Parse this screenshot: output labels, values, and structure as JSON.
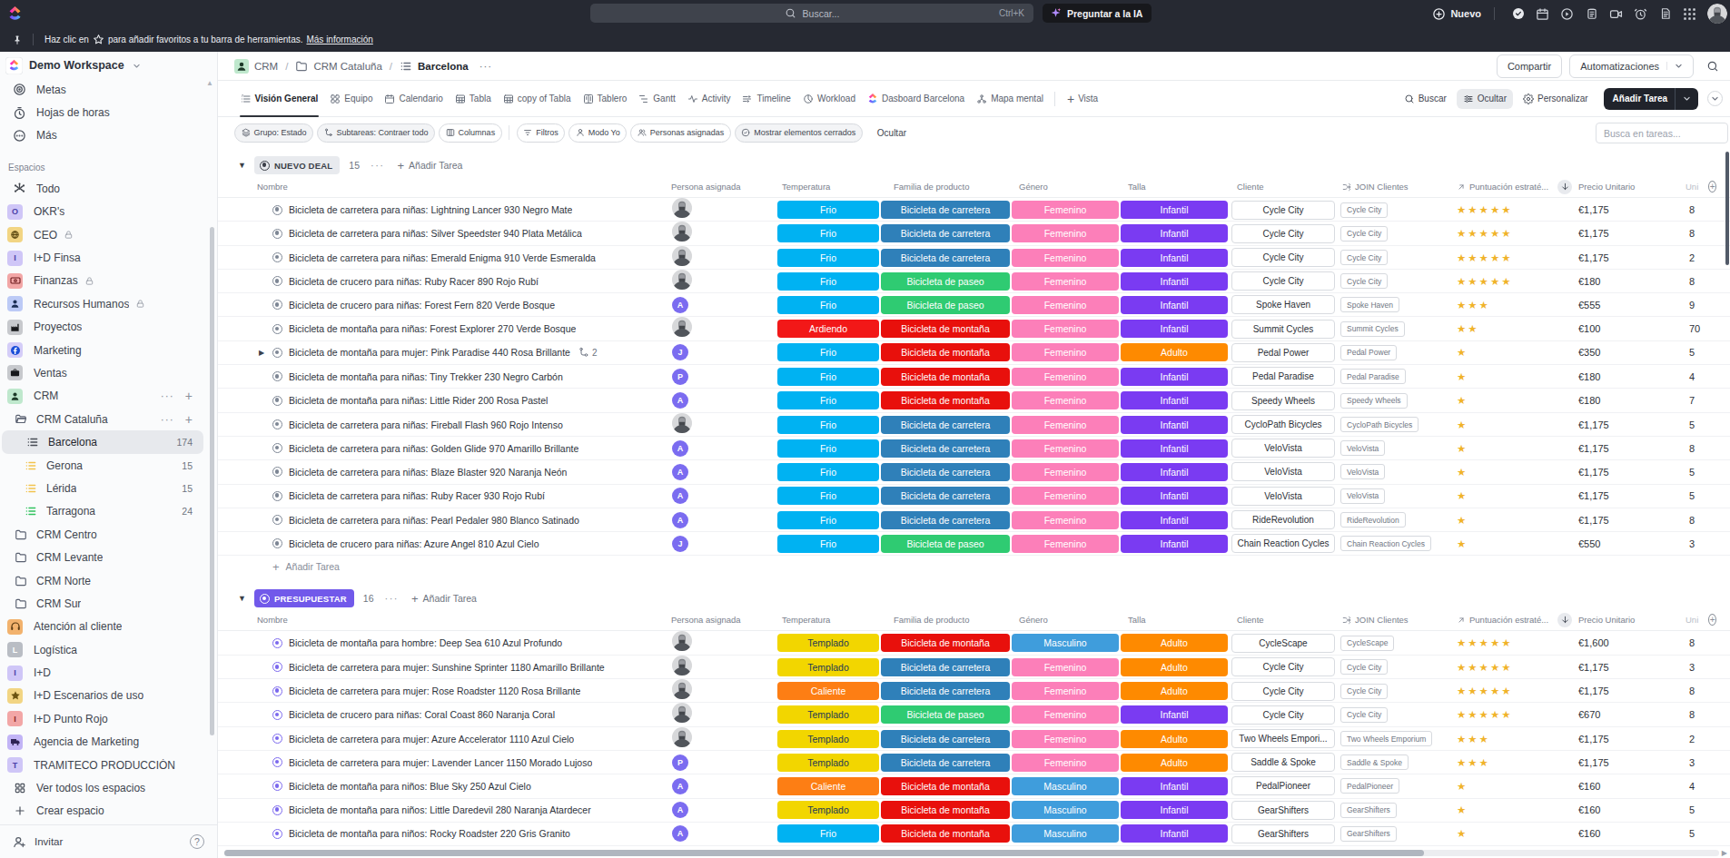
{
  "topbar": {
    "search": {
      "placeholder": "Buscar...",
      "shortcut": "Ctrl+K"
    },
    "ask_ai_label": "Preguntar a la IA",
    "new_label": "Nuevo",
    "icons": [
      "todo-check-icon",
      "calendar-icon",
      "record-icon",
      "clipboard-icon",
      "video-icon",
      "reminder-icon",
      "notepad-icon",
      "app-grid-icon"
    ]
  },
  "banner": {
    "text_before": "Haz clic en",
    "text_after": "para añadir favoritos a tu barra de herramientas.",
    "link_label": "Más información"
  },
  "sidebar": {
    "workspace_name": "Demo Workspace",
    "section_label": "Espacios",
    "items": [
      {
        "type": "item",
        "label": "Metas",
        "icon": "goal"
      },
      {
        "type": "item",
        "label": "Hojas de horas",
        "icon": "timer"
      },
      {
        "type": "item",
        "label": "Más",
        "icon": "more-circle"
      },
      {
        "type": "section",
        "label": "Espacios"
      },
      {
        "type": "item",
        "label": "Todo",
        "icon": "everything"
      },
      {
        "type": "space",
        "label": "OKR's",
        "letter": "O",
        "bg": "#cfc6f7",
        "fg": "#4b3fa8"
      },
      {
        "type": "space",
        "label": "CEO",
        "icon": "gear-globe",
        "bg": "#f2d583",
        "fg": "#5d4a11",
        "lock": true
      },
      {
        "type": "space",
        "label": "I+D Finsa",
        "letter": "I",
        "bg": "#cfc6f7",
        "fg": "#4b3fa8"
      },
      {
        "type": "space",
        "label": "Finanzas",
        "icon": "banknote",
        "bg": "#f2a6a6",
        "fg": "#6d1a1d",
        "lock": true
      },
      {
        "type": "space",
        "label": "Recursos Humanos",
        "icon": "person",
        "bg": "#bccaf6",
        "fg": "#1c2f55",
        "lock": true
      },
      {
        "type": "space",
        "label": "Proyectos",
        "icon": "factory",
        "bg": "#c7c9cd",
        "fg": "#17181b"
      },
      {
        "type": "space",
        "label": "Marketing",
        "icon": "meta",
        "bg": "#d4cdf8",
        "fg": "#1b4ed8"
      },
      {
        "type": "space",
        "label": "Ventas",
        "icon": "briefcase",
        "bg": "#c7c9cd",
        "fg": "#17181b"
      },
      {
        "type": "space",
        "label": "CRM",
        "icon": "person",
        "bg": "#bfe8cd",
        "fg": "#1d3a28",
        "hover": true
      },
      {
        "type": "folder",
        "label": "CRM Cataluña",
        "open": true,
        "hover": true
      },
      {
        "type": "list",
        "label": "Barcelona",
        "count": "174",
        "color": "#474c55",
        "selected": true
      },
      {
        "type": "list",
        "label": "Gerona",
        "count": "15",
        "color": "#f2c34c"
      },
      {
        "type": "list",
        "label": "Lérida",
        "count": "15",
        "color": "#f2c34c"
      },
      {
        "type": "list",
        "label": "Tarragona",
        "count": "24",
        "color": "#31c25e"
      },
      {
        "type": "folder",
        "label": "CRM Centro"
      },
      {
        "type": "folder",
        "label": "CRM Levante"
      },
      {
        "type": "folder",
        "label": "CRM Norte"
      },
      {
        "type": "folder",
        "label": "CRM Sur"
      },
      {
        "type": "space",
        "label": "Atención al cliente",
        "icon": "headset",
        "bg": "#f2b26d",
        "fg": "#5a3a12"
      },
      {
        "type": "space",
        "label": "Logística",
        "letter": "L",
        "bg": "#b9bdc4",
        "fg": "#fff"
      },
      {
        "type": "space",
        "label": "I+D",
        "letter": "I",
        "bg": "#cfc6f7",
        "fg": "#4b3fa8"
      },
      {
        "type": "space",
        "label": "I+D Escenarios de uso",
        "icon": "star",
        "bg": "#f2d583",
        "fg": "#6b5410"
      },
      {
        "type": "space",
        "label": "I+D Punto Rojo",
        "letter": "I",
        "bg": "#f2a6a6",
        "fg": "#8a2424"
      },
      {
        "type": "space",
        "label": "Agencia de Marketing",
        "icon": "truck",
        "bg": "#c2b4f6",
        "fg": "#2e2355"
      },
      {
        "type": "space",
        "label": "TRAMITECO PRODUCCIÓN",
        "letter": "T",
        "bg": "#cfc6f7",
        "fg": "#4b3fa8"
      },
      {
        "type": "item",
        "label": "Ver todos los espacios",
        "icon": "grid4"
      },
      {
        "type": "item",
        "label": "Crear espacio",
        "icon": "plus"
      }
    ],
    "footer": {
      "invite_label": "Invitar",
      "help_icon": "help"
    }
  },
  "breadcrumb": {
    "crumbs": [
      {
        "label": "CRM",
        "icon": "crm-space"
      },
      {
        "label": "CRM Cataluña",
        "icon": "folder"
      },
      {
        "label": "Barcelona",
        "icon": "list-lines",
        "current": true
      }
    ],
    "more": "···",
    "share_label": "Compartir",
    "automations_label": "Automatizaciones"
  },
  "view_tabs": {
    "tabs": [
      {
        "label": "Visión General",
        "icon": "overview",
        "active": true
      },
      {
        "label": "Equipo",
        "icon": "team"
      },
      {
        "label": "Calendario",
        "icon": "calendar2"
      },
      {
        "label": "Tabla",
        "icon": "table"
      },
      {
        "label": "copy of Tabla",
        "icon": "table"
      },
      {
        "label": "Tablero",
        "icon": "board"
      },
      {
        "label": "Gantt",
        "icon": "gantt"
      },
      {
        "label": "Activity",
        "icon": "activity"
      },
      {
        "label": "Timeline",
        "icon": "timeline"
      },
      {
        "label": "Workload",
        "icon": "workload"
      },
      {
        "label": "Dasboard Barcelona",
        "icon": "clickup-color"
      },
      {
        "label": "Mapa mental",
        "icon": "mindmap"
      }
    ],
    "add_view_label": "Vista",
    "search_label": "Buscar",
    "hide_label": "Ocultar",
    "customize_label": "Personalizar",
    "add_task_label": "Añadir Tarea"
  },
  "toolbar": {
    "pills": [
      {
        "label": "Grupo: Estado",
        "icon": "layers",
        "shaded": true
      },
      {
        "label": "Subtareas: Contraer todo",
        "icon": "subtask",
        "shaded": true
      },
      {
        "label": "Columnas",
        "icon": "columns",
        "shaded": false,
        "sep_after": true
      },
      {
        "label": "Filtros",
        "icon": "filter",
        "shaded": false
      },
      {
        "label": "Modo Yo",
        "icon": "person-o",
        "shaded": false
      },
      {
        "label": "Personas asignadas",
        "icon": "people",
        "shaded": false
      },
      {
        "label": "Mostrar elementos cerrados",
        "icon": "check-circle",
        "shaded": true
      }
    ],
    "plain_label": "Ocultar",
    "task_search_placeholder": "Busca en tareas..."
  },
  "table": {
    "columns": {
      "name": "Nombre",
      "assignee": "Persona asignada",
      "temperatura": "Temperatura",
      "familia": "Familia de producto",
      "genero": "Género",
      "talla": "Talla",
      "cliente": "Cliente",
      "join": "JOIN Clientes",
      "puntuacion": "Puntuación estraté...",
      "precio": "Precio Unitario",
      "unidades": "Uni"
    },
    "add_task_label": "Añadir Tarea",
    "option_colors": {
      "Frio": {
        "bg": "#00b2f2",
        "fg": "#fff"
      },
      "Ardiendo": {
        "bg": "#f21818",
        "fg": "#fff"
      },
      "Templado": {
        "bg": "#f2d600",
        "fg": "#233a56"
      },
      "Caliente": {
        "bg": "#fd7e14",
        "fg": "#fff"
      },
      "Bicicleta de carretera": {
        "bg": "#2f80b9",
        "fg": "#fff"
      },
      "Bicicleta de paseo": {
        "bg": "#2fcb72",
        "fg": "#fff"
      },
      "Bicicleta de montaña": {
        "bg": "#e8100c",
        "fg": "#fff"
      },
      "Femenino": {
        "bg": "#fc7fb9",
        "fg": "#fff"
      },
      "Masculino": {
        "bg": "#3f9ddc",
        "fg": "#fff"
      },
      "Infantil": {
        "bg": "#7a3bf2",
        "fg": "#fff"
      },
      "Adulto": {
        "bg": "#fe8a00",
        "fg": "#fff"
      }
    },
    "star_color": "#f0b32a",
    "avatar_color": "#7b6cf0",
    "groups": [
      {
        "status": "NUEVO DEAL",
        "pill_bg": "#e8eaee",
        "pill_fg": "#3b3f48",
        "dot_color": "#7d8694",
        "count": "15",
        "show_add_row": true,
        "rows": [
          {
            "name": "Bicicleta de carretera para niñas: Lightning Lancer 930 Negro Mate",
            "avatar": "photo",
            "temperatura": "Frio",
            "familia": "Bicicleta de carretera",
            "genero": "Femenino",
            "talla": "Infantil",
            "cliente": "Cycle City",
            "join": "Cycle City",
            "stars": 5,
            "precio": "€1,175",
            "unidades": "8"
          },
          {
            "name": "Bicicleta de carretera para niñas: Silver Speedster 940 Plata Metálica",
            "avatar": "photo",
            "temperatura": "Frio",
            "familia": "Bicicleta de carretera",
            "genero": "Femenino",
            "talla": "Infantil",
            "cliente": "Cycle City",
            "join": "Cycle City",
            "stars": 5,
            "precio": "€1,175",
            "unidades": "8"
          },
          {
            "name": "Bicicleta de carretera para niñas: Emerald Enigma 910 Verde Esmeralda",
            "avatar": "photo",
            "temperatura": "Frio",
            "familia": "Bicicleta de carretera",
            "genero": "Femenino",
            "talla": "Infantil",
            "cliente": "Cycle City",
            "join": "Cycle City",
            "stars": 5,
            "precio": "€1,175",
            "unidades": "2"
          },
          {
            "name": "Bicicleta de crucero para niñas: Ruby Racer 890 Rojo Rubí",
            "avatar": "photo",
            "temperatura": "Frio",
            "familia": "Bicicleta de paseo",
            "genero": "Femenino",
            "talla": "Infantil",
            "cliente": "Cycle City",
            "join": "Cycle City",
            "stars": 5,
            "precio": "€180",
            "unidades": "8"
          },
          {
            "name": "Bicicleta de crucero para niñas: Forest Fern 820 Verde Bosque",
            "avatar": "A",
            "temperatura": "Frio",
            "familia": "Bicicleta de paseo",
            "genero": "Femenino",
            "talla": "Infantil",
            "cliente": "Spoke Haven",
            "join": "Spoke Haven",
            "stars": 3,
            "precio": "€555",
            "unidades": "9"
          },
          {
            "name": "Bicicleta de montaña para niñas: Forest Explorer 270 Verde Bosque",
            "avatar": "photo",
            "temperatura": "Ardiendo",
            "familia": "Bicicleta de montaña",
            "genero": "Femenino",
            "talla": "Infantil",
            "cliente": "Summit Cycles",
            "join": "Summit Cycles",
            "stars": 2,
            "precio": "€100",
            "unidades": "70"
          },
          {
            "name": "Bicicleta de montaña para mujer: Pink Paradise 440 Rosa Brillante",
            "avatar": "J",
            "temperatura": "Frio",
            "familia": "Bicicleta de montaña",
            "genero": "Femenino",
            "talla": "Adulto",
            "cliente": "Pedal Power",
            "join": "Pedal Power",
            "stars": 1,
            "precio": "€350",
            "unidades": "5",
            "expandable": true,
            "subtasks": "2"
          },
          {
            "name": "Bicicleta de montaña para niñas: Tiny Trekker 230 Negro Carbón",
            "avatar": "P",
            "temperatura": "Frio",
            "familia": "Bicicleta de montaña",
            "genero": "Femenino",
            "talla": "Infantil",
            "cliente": "Pedal Paradise",
            "join": "Pedal Paradise",
            "stars": 1,
            "precio": "€180",
            "unidades": "4"
          },
          {
            "name": "Bicicleta de montaña para niñas: Little Rider 200 Rosa Pastel",
            "avatar": "A",
            "temperatura": "Frio",
            "familia": "Bicicleta de montaña",
            "genero": "Femenino",
            "talla": "Infantil",
            "cliente": "Speedy Wheels",
            "join": "Speedy Wheels",
            "stars": 1,
            "precio": "€180",
            "unidades": "7"
          },
          {
            "name": "Bicicleta de carretera para niñas: Fireball Flash 960 Rojo Intenso",
            "avatar": "photo",
            "temperatura": "Frio",
            "familia": "Bicicleta de carretera",
            "genero": "Femenino",
            "talla": "Infantil",
            "cliente": "CycloPath Bicycles",
            "join": "CycloPath Bicycles",
            "stars": 1,
            "precio": "€1,175",
            "unidades": "5"
          },
          {
            "name": "Bicicleta de carretera para niñas: Golden Glide 970 Amarillo Brillante",
            "avatar": "A",
            "temperatura": "Frio",
            "familia": "Bicicleta de carretera",
            "genero": "Femenino",
            "talla": "Infantil",
            "cliente": "VeloVista",
            "join": "VeloVista",
            "stars": 1,
            "precio": "€1,175",
            "unidades": "8"
          },
          {
            "name": "Bicicleta de carretera para niñas: Blaze Blaster 920 Naranja Neón",
            "avatar": "A",
            "temperatura": "Frio",
            "familia": "Bicicleta de carretera",
            "genero": "Femenino",
            "talla": "Infantil",
            "cliente": "VeloVista",
            "join": "VeloVista",
            "stars": 1,
            "precio": "€1,175",
            "unidades": "5"
          },
          {
            "name": "Bicicleta de carretera para niñas: Ruby Racer 930 Rojo Rubí",
            "avatar": "A",
            "temperatura": "Frio",
            "familia": "Bicicleta de carretera",
            "genero": "Femenino",
            "talla": "Infantil",
            "cliente": "VeloVista",
            "join": "VeloVista",
            "stars": 1,
            "precio": "€1,175",
            "unidades": "5"
          },
          {
            "name": "Bicicleta de carretera para niñas: Pearl Pedaler 980 Blanco Satinado",
            "avatar": "A",
            "temperatura": "Frio",
            "familia": "Bicicleta de carretera",
            "genero": "Femenino",
            "talla": "Infantil",
            "cliente": "RideRevolution",
            "join": "RideRevolution",
            "stars": 1,
            "precio": "€1,175",
            "unidades": "8"
          },
          {
            "name": "Bicicleta de crucero para niñas: Azure Angel 810 Azul Cielo",
            "avatar": "J",
            "temperatura": "Frio",
            "familia": "Bicicleta de paseo",
            "genero": "Femenino",
            "talla": "Infantil",
            "cliente": "Chain Reaction Cycles",
            "join": "Chain Reaction Cycles",
            "stars": 1,
            "precio": "€550",
            "unidades": "3"
          }
        ]
      },
      {
        "status": "PRESUPUESTAR",
        "pill_bg": "#7159ea",
        "pill_fg": "#ffffff",
        "dot_color": "#7b68ee",
        "count": "16",
        "show_add_row": false,
        "rows": [
          {
            "name": "Bicicleta de montaña para hombre: Deep Sea 610 Azul Profundo",
            "avatar": "photo",
            "temperatura": "Templado",
            "familia": "Bicicleta de montaña",
            "genero": "Masculino",
            "talla": "Adulto",
            "cliente": "CycleScape",
            "join": "CycleScape",
            "stars": 5,
            "precio": "€1,600",
            "unidades": "8"
          },
          {
            "name": "Bicicleta de carretera para mujer: Sunshine Sprinter 1180 Amarillo Brillante",
            "avatar": "photo",
            "temperatura": "Templado",
            "familia": "Bicicleta de carretera",
            "genero": "Femenino",
            "talla": "Adulto",
            "cliente": "Cycle City",
            "join": "Cycle City",
            "stars": 5,
            "precio": "€1,175",
            "unidades": "3"
          },
          {
            "name": "Bicicleta de carretera para mujer: Rose Roadster 1120 Rosa Brillante",
            "avatar": "photo",
            "temperatura": "Caliente",
            "familia": "Bicicleta de carretera",
            "genero": "Femenino",
            "talla": "Adulto",
            "cliente": "Cycle City",
            "join": "Cycle City",
            "stars": 5,
            "precio": "€1,175",
            "unidades": "8"
          },
          {
            "name": "Bicicleta de crucero para niñas: Coral Coast 860 Naranja Coral",
            "avatar": "photo",
            "temperatura": "Templado",
            "familia": "Bicicleta de paseo",
            "genero": "Femenino",
            "talla": "Infantil",
            "cliente": "Cycle City",
            "join": "Cycle City",
            "stars": 5,
            "precio": "€670",
            "unidades": "8"
          },
          {
            "name": "Bicicleta de carretera para mujer: Azure Accelerator 1110 Azul Cielo",
            "avatar": "photo",
            "temperatura": "Templado",
            "familia": "Bicicleta de carretera",
            "genero": "Femenino",
            "talla": "Adulto",
            "cliente": "Two Wheels Empori...",
            "join": "Two Wheels Emporium",
            "stars": 3,
            "precio": "€1,175",
            "unidades": "2"
          },
          {
            "name": "Bicicleta de carretera para mujer: Lavender Lancer 1150 Morado Lujoso",
            "avatar": "P",
            "temperatura": "Templado",
            "familia": "Bicicleta de carretera",
            "genero": "Femenino",
            "talla": "Adulto",
            "cliente": "Saddle & Spoke",
            "join": "Saddle & Spoke",
            "stars": 3,
            "precio": "€1,175",
            "unidades": "3"
          },
          {
            "name": "Bicicleta de montaña para niños: Blue Sky 250 Azul Cielo",
            "avatar": "A",
            "temperatura": "Caliente",
            "familia": "Bicicleta de montaña",
            "genero": "Masculino",
            "talla": "Infantil",
            "cliente": "PedalPioneer",
            "join": "PedalPioneer",
            "stars": 1,
            "precio": "€160",
            "unidades": "4"
          },
          {
            "name": "Bicicleta de montaña para niños: Little Daredevil 280 Naranja Atardecer",
            "avatar": "A",
            "temperatura": "Templado",
            "familia": "Bicicleta de montaña",
            "genero": "Masculino",
            "talla": "Infantil",
            "cliente": "GearShifters",
            "join": "GearShifters",
            "stars": 1,
            "precio": "€160",
            "unidades": "5"
          },
          {
            "name": "Bicicleta de montaña para niños: Rocky Roadster 220 Gris Granito",
            "avatar": "A",
            "temperatura": "Frio",
            "familia": "Bicicleta de montaña",
            "genero": "Masculino",
            "talla": "Infantil",
            "cliente": "GearShifters",
            "join": "GearShifters",
            "stars": 1,
            "precio": "€160",
            "unidades": "5"
          }
        ]
      }
    ]
  }
}
